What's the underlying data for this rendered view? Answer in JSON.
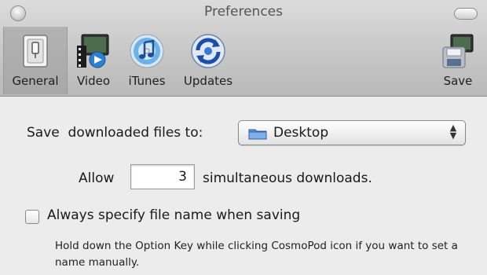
{
  "window": {
    "title": "Preferences"
  },
  "toolbar": {
    "items": [
      {
        "label": "General",
        "icon": "general-switch-icon",
        "selected": true
      },
      {
        "label": "Video",
        "icon": "video-icon",
        "selected": false
      },
      {
        "label": "iTunes",
        "icon": "itunes-icon",
        "selected": false
      },
      {
        "label": "Updates",
        "icon": "updates-icon",
        "selected": false
      }
    ],
    "save": {
      "label": "Save",
      "icon": "save-icon"
    }
  },
  "general": {
    "save_to_label": "Save  downloaded files to:",
    "destination": {
      "value": "Desktop",
      "icon": "folder-icon"
    },
    "allow_label": "Allow",
    "simultaneous_count": "3",
    "simultaneous_label": "simultaneous downloads.",
    "specify_name": {
      "label": "Always specify file name when saving",
      "checked": false
    },
    "hint": "Hold down the Option Key while clicking CosmoPod icon if you want to set a name manually."
  },
  "colors": {
    "window_bg": "#ececec",
    "toolbar_selected": "#adadad",
    "folder_blue": "#5b8fd1"
  }
}
